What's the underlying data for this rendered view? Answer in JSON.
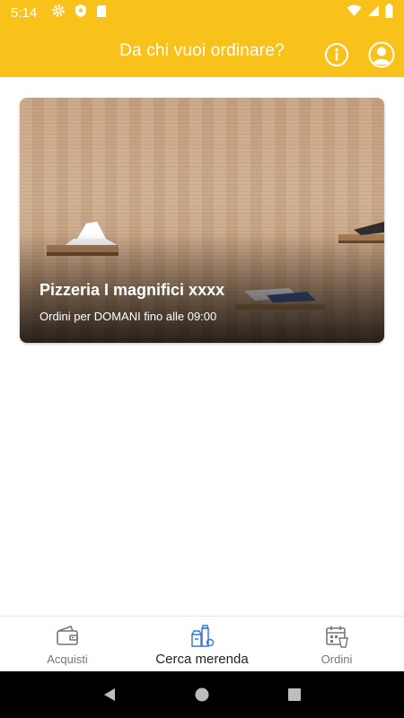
{
  "status_bar": {
    "time": "5:14",
    "icons": [
      "settings-icon",
      "shield-icon",
      "sd-card-icon",
      "wifi-icon",
      "signal-icon",
      "battery-icon"
    ]
  },
  "header": {
    "title": "Da chi vuoi ordinare?",
    "icons": [
      "info-icon",
      "account-icon"
    ]
  },
  "vendors": [
    {
      "name": "Pizzeria I magnifici xxxx",
      "order_info": "Ordini per DOMANI fino alle 09:00"
    }
  ],
  "bottom_nav": {
    "items": [
      {
        "label": "Acquisti",
        "icon": "wallet-icon"
      },
      {
        "label": "Cerca merenda",
        "icon": "snacks-icon"
      },
      {
        "label": "Ordini",
        "icon": "calendar-orders-icon"
      }
    ],
    "active_index": 1
  },
  "colors": {
    "brand_yellow": "#f9c21b",
    "active_icon_blue": "#3a7bd5"
  }
}
